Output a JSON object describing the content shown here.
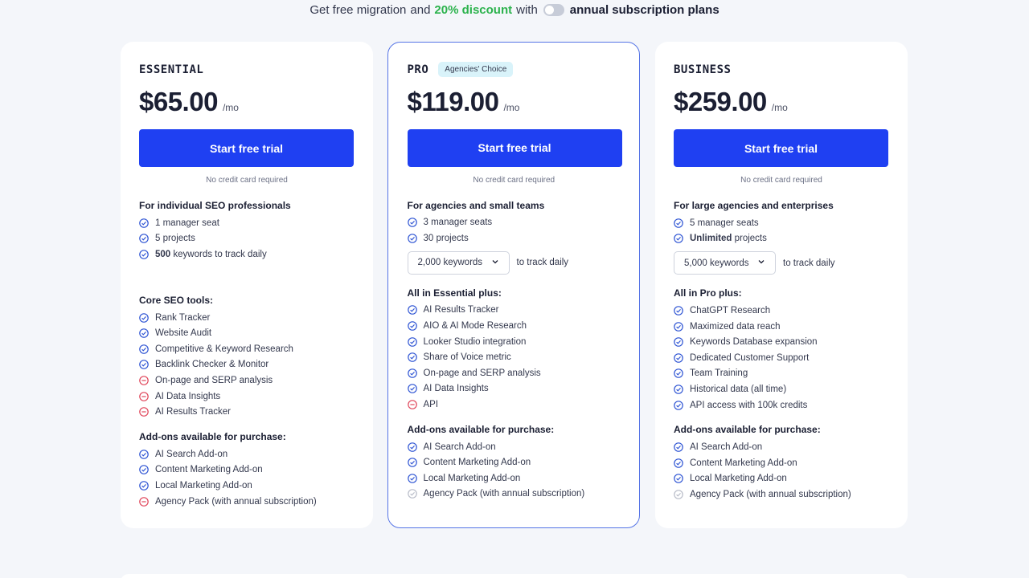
{
  "promo": {
    "part1": "Get free migration",
    "part2": "and",
    "discount": "20% discount",
    "part3": "with",
    "part4": "annual subscription plans"
  },
  "plans": [
    {
      "name": "ESSENTIAL",
      "price": "$65.00",
      "per": "/mo",
      "cta": "Start free trial",
      "no_cc": "No credit card required",
      "audience": "For individual SEO professionals",
      "limits": [
        {
          "text": "1 manager seat",
          "icon": "check"
        },
        {
          "text": "5 projects",
          "icon": "check"
        },
        {
          "bold": "500",
          "text": " keywords to track daily",
          "icon": "check"
        }
      ],
      "tools_title": "Core SEO tools:",
      "tools": [
        {
          "text": "Rank Tracker",
          "icon": "check"
        },
        {
          "text": "Website Audit",
          "icon": "check"
        },
        {
          "text": "Competitive & Keyword Research",
          "icon": "check"
        },
        {
          "text": "Backlink Checker & Monitor",
          "icon": "check"
        },
        {
          "text": "On-page and SERP analysis",
          "icon": "minus"
        },
        {
          "text": "AI Data Insights",
          "icon": "minus"
        },
        {
          "text": "AI Results Tracker",
          "icon": "minus"
        }
      ],
      "addons_title": "Add-ons available for purchase:",
      "addons": [
        {
          "text": "AI Search Add-on",
          "icon": "check"
        },
        {
          "text": "Content Marketing Add-on",
          "icon": "check"
        },
        {
          "text": "Local Marketing Add-on",
          "icon": "check"
        },
        {
          "text": "Agency Pack (with annual subscription)",
          "icon": "minus"
        }
      ]
    },
    {
      "name": "PRO",
      "badge": "Agencies' Choice",
      "price": "$119.00",
      "per": "/mo",
      "cta": "Start free trial",
      "no_cc": "No credit card required",
      "audience": "For agencies and small teams",
      "limits": [
        {
          "text": "3 manager seats",
          "icon": "check"
        },
        {
          "text": "30 projects",
          "icon": "check"
        }
      ],
      "keywords_select": "2,000 keywords",
      "keywords_suffix": "to track daily",
      "tools_title": "All in Essential plus:",
      "tools": [
        {
          "text": "AI Results Tracker",
          "icon": "check"
        },
        {
          "text": "AIO & AI Mode Research",
          "icon": "check"
        },
        {
          "text": "Looker Studio integration",
          "icon": "check"
        },
        {
          "text": "Share of Voice metric",
          "icon": "check"
        },
        {
          "text": "On-page and SERP analysis",
          "icon": "check"
        },
        {
          "text": "AI Data Insights",
          "icon": "check"
        },
        {
          "text": "API",
          "icon": "minus"
        }
      ],
      "addons_title": "Add-ons available for purchase:",
      "addons": [
        {
          "text": "AI Search Add-on",
          "icon": "check"
        },
        {
          "text": "Content Marketing Add-on",
          "icon": "check"
        },
        {
          "text": "Local Marketing Add-on",
          "icon": "check"
        },
        {
          "text": "Agency Pack (with annual subscription)",
          "icon": "check-muted"
        }
      ]
    },
    {
      "name": "BUSINESS",
      "price": "$259.00",
      "per": "/mo",
      "cta": "Start free trial",
      "no_cc": "No credit card required",
      "audience": "For large agencies and enterprises",
      "limits": [
        {
          "text": "5 manager seats",
          "icon": "check"
        },
        {
          "bold": "Unlimited",
          "text": " projects",
          "icon": "check"
        }
      ],
      "keywords_select": "5,000 keywords",
      "keywords_suffix": "to track daily",
      "tools_title": "All in Pro plus:",
      "tools": [
        {
          "text": "ChatGPT Research",
          "icon": "check"
        },
        {
          "text": "Maximized data reach",
          "icon": "check"
        },
        {
          "text": "Keywords Database expansion",
          "icon": "check"
        },
        {
          "text": "Dedicated Customer Support",
          "icon": "check"
        },
        {
          "text": "Team Training",
          "icon": "check"
        },
        {
          "text": "Historical data (all time)",
          "icon": "check"
        },
        {
          "text": "API access with 100k credits",
          "icon": "check"
        }
      ],
      "addons_title": "Add-ons available for purchase:",
      "addons": [
        {
          "text": "AI Search Add-on",
          "icon": "check"
        },
        {
          "text": "Content Marketing Add-on",
          "icon": "check"
        },
        {
          "text": "Local Marketing Add-on",
          "icon": "check"
        },
        {
          "text": "Agency Pack (with annual subscription)",
          "icon": "check-muted"
        }
      ]
    }
  ],
  "colors": {
    "accent": "#1f40f2",
    "check": "#2f55d4",
    "minus": "#e0455a",
    "muted": "#b8bcc8",
    "discount": "#2bb24c"
  }
}
